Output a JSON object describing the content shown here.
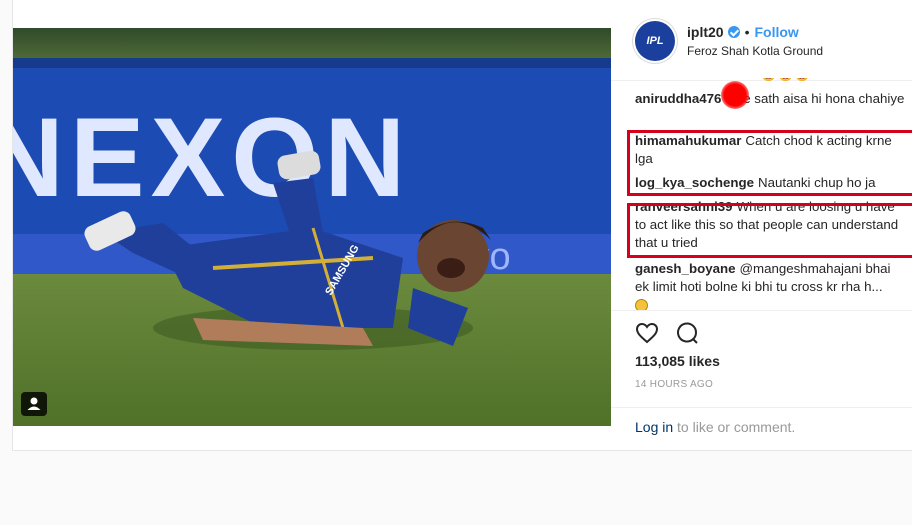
{
  "header": {
    "avatar_text": "IPL",
    "username": "iplt20",
    "separator": "•",
    "follow_label": "Follow",
    "location": "Feroz Shah Kotla Ground"
  },
  "photo": {
    "boundary_text": "NEXON",
    "board_text": "vivo",
    "jersey_text": "SAMSUNG"
  },
  "comments": [
    {
      "user": "aniruddha476",
      "text": "e ke sath aisa hi hona chahiye"
    },
    {
      "user": "himamahukumar",
      "text": "Catch chod k acting krne lga"
    },
    {
      "user": "log_kya_sochenge",
      "text": "Nautanki chup ho ja"
    },
    {
      "user": "ranveersahni39",
      "text": "When u are loosing u have to act like this so that people can understand that u tried"
    },
    {
      "user": "ganesh_boyane",
      "text": "@mangeshmahajani bhai ek limit hoti bolne ki bhi tu cross kr rha h..."
    }
  ],
  "emoji_row": "😂😂😂",
  "likes": "113,085 likes",
  "timestamp": "14 HOURS AGO",
  "login": {
    "link": "Log in",
    "rest": " to like or comment."
  },
  "more_label": "⋯",
  "colors": {
    "accent": "#3897f0",
    "highlight": "#d6001c",
    "jersey": "#1f3f9a"
  },
  "icons": [
    "heart-icon",
    "comment-icon",
    "tag-user-icon",
    "verified-icon"
  ]
}
